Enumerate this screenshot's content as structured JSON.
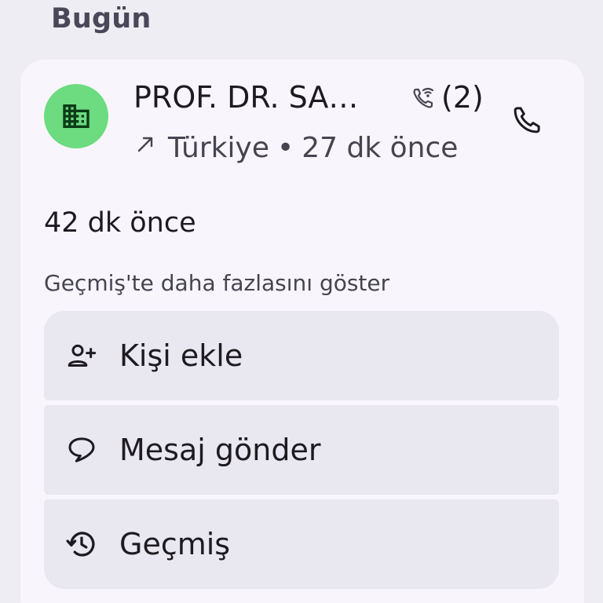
{
  "section": {
    "title": "Bugün"
  },
  "contact": {
    "name": "PROF. DR. SA…",
    "call_count": "(2)",
    "location": "Türkiye",
    "separator": "•",
    "time_ago": "27 dk önce",
    "avatar_color": "#6ddb7f",
    "avatar_icon": "business-icon"
  },
  "details": {
    "previous_call_time": "42 dk önce",
    "history_link": "Geçmiş'te daha fazlasını göster"
  },
  "actions": [
    {
      "label": "Kişi ekle",
      "icon": "add-person-icon"
    },
    {
      "label": "Mesaj gönder",
      "icon": "message-icon"
    },
    {
      "label": "Geçmiş",
      "icon": "history-icon"
    }
  ]
}
